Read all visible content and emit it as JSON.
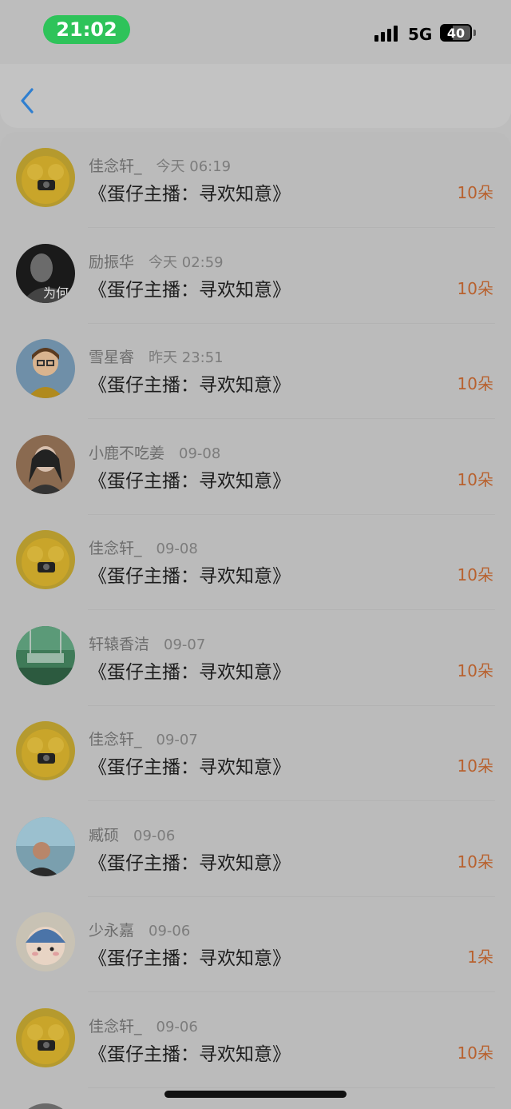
{
  "status": {
    "time": "21:02",
    "network": "5G",
    "battery": "40",
    "battery_level_percent": 40
  },
  "nav": {
    "back_icon": "chevron-left-icon",
    "accent": "#2f7fd0"
  },
  "colors": {
    "time_pill": "#2ec35a",
    "count_text": "#b8612e"
  },
  "records": [
    {
      "user": "佳念轩_",
      "date": "今天 06:19",
      "title": "《蛋仔主播：寻欢知意》",
      "count": "10朵",
      "avatar": "yellow-dog-avatar"
    },
    {
      "user": "励振华",
      "date": "今天 02:59",
      "title": "《蛋仔主播：寻欢知意》",
      "count": "10朵",
      "avatar": "dark-portrait-avatar",
      "avatar_text": "为何"
    },
    {
      "user": "雪星睿",
      "date": "昨天 23:51",
      "title": "《蛋仔主播：寻欢知意》",
      "count": "10朵",
      "avatar": "cartoon-boy-avatar"
    },
    {
      "user": "小鹿不吃姜",
      "date": "09-08",
      "title": "《蛋仔主播：寻欢知意》",
      "count": "10朵",
      "avatar": "girl-photo-avatar"
    },
    {
      "user": "佳念轩_",
      "date": "09-08",
      "title": "《蛋仔主播：寻欢知意》",
      "count": "10朵",
      "avatar": "yellow-dog-avatar"
    },
    {
      "user": "轩辕香洁",
      "date": "09-07",
      "title": "《蛋仔主播：寻欢知意》",
      "count": "10朵",
      "avatar": "green-swing-avatar"
    },
    {
      "user": "佳念轩_",
      "date": "09-07",
      "title": "《蛋仔主播：寻欢知意》",
      "count": "10朵",
      "avatar": "yellow-dog-avatar"
    },
    {
      "user": "臧硕",
      "date": "09-06",
      "title": "《蛋仔主播：寻欢知意》",
      "count": "10朵",
      "avatar": "man-photo-avatar"
    },
    {
      "user": "少永嘉",
      "date": "09-06",
      "title": "《蛋仔主播：寻欢知意》",
      "count": "1朵",
      "avatar": "cartoon-hat-avatar"
    },
    {
      "user": "佳念轩_",
      "date": "09-06",
      "title": "《蛋仔主播：寻欢知意》",
      "count": "10朵",
      "avatar": "yellow-dog-avatar"
    }
  ]
}
